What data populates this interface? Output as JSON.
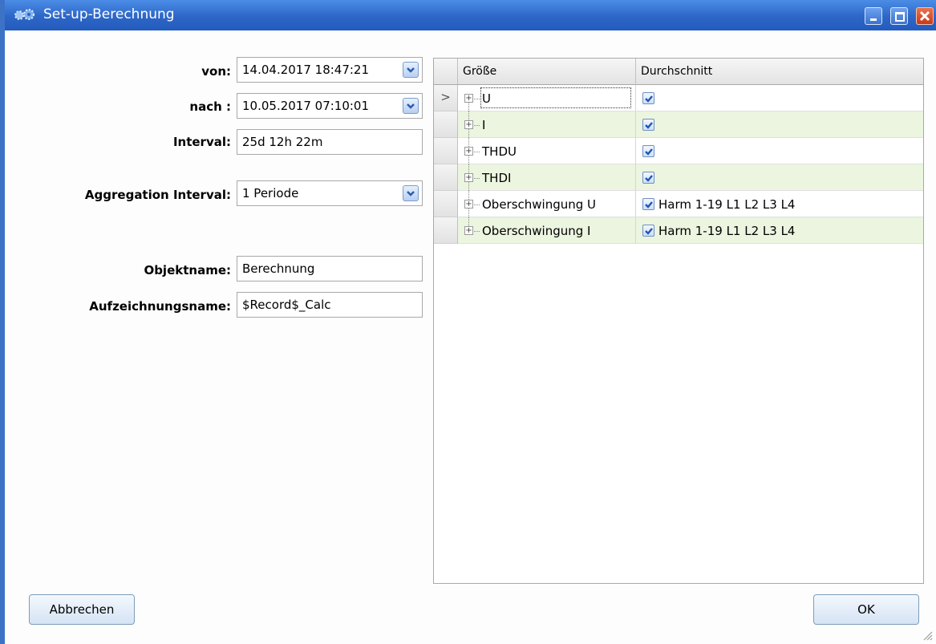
{
  "window": {
    "title": "Set-up-Berechnung",
    "accent_color": "#2d66c7"
  },
  "form": {
    "von_label": "von:",
    "von_value": "14.04.2017 18:47:21",
    "nach_label": "nach :",
    "nach_value": "10.05.2017 07:10:01",
    "interval_label": "Interval:",
    "interval_value": "25d 12h 22m",
    "aggregation_label": "Aggregation Interval:",
    "aggregation_value": "1 Periode",
    "objektname_label": "Objektname:",
    "objektname_value": "Berechnung",
    "aufzeichnungsname_label": "Aufzeichnungsname:",
    "aufzeichnungsname_value": "$Record$_Calc"
  },
  "grid": {
    "columns": [
      "Größe",
      "Durchschnitt"
    ],
    "rows": [
      {
        "name": "U",
        "checked": true,
        "avg_text": ""
      },
      {
        "name": "I",
        "checked": true,
        "avg_text": ""
      },
      {
        "name": "THDU",
        "checked": true,
        "avg_text": ""
      },
      {
        "name": "THDI",
        "checked": true,
        "avg_text": ""
      },
      {
        "name": "Oberschwingung U",
        "checked": true,
        "avg_text": "Harm 1-19 L1 L2 L3 L4"
      },
      {
        "name": "Oberschwingung I",
        "checked": true,
        "avg_text": "Harm 1-19 L1 L2 L3 L4"
      }
    ],
    "row_alt_color": "#ebf5df",
    "current_row_indicator": ">",
    "expand_icon": "plus-box-icon",
    "check_icon": "checkmark-icon"
  },
  "buttons": {
    "cancel": "Abbrechen",
    "ok": "OK"
  }
}
